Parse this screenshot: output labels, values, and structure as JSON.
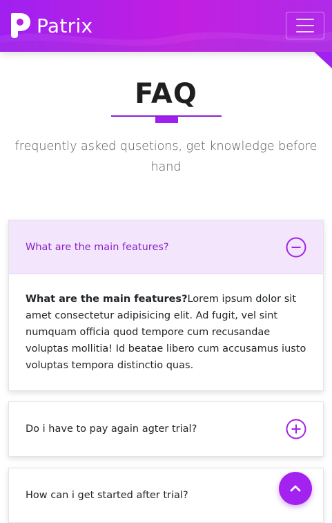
{
  "brand": {
    "name": "Patrix",
    "logo_icon": "patrix-p-logo-icon"
  },
  "nav": {
    "toggler_icon": "hamburger-menu-icon"
  },
  "section": {
    "title": "FAQ",
    "subtitle": "frequently asked qusetions, get knowledge before hand"
  },
  "faq": [
    {
      "question": "What are the main features?",
      "expanded": true,
      "icon": "minus-circle-icon",
      "answer_lead": "What are the main features?",
      "answer_text": "Lorem ipsum dolor sit amet consectetur adipisicing elit. Ad fugit, vel sint numquam officia quod tempore cum recusandae voluptas mollitia! Id beatae libero cum accusamus iusto voluptas tempora distinctio quas."
    },
    {
      "question": "Do i have to pay again agter trial?",
      "expanded": false,
      "icon": "plus-circle-icon"
    },
    {
      "question": "How can i get started after trial?",
      "expanded": false,
      "icon": "plus-circle-icon"
    }
  ],
  "scroll_top": {
    "icon": "chevron-up-icon"
  },
  "colors": {
    "accent": "#a020f0",
    "accent_dark": "#8a1ec8",
    "accent_light": "#f3e6fc",
    "text": "#212529"
  }
}
